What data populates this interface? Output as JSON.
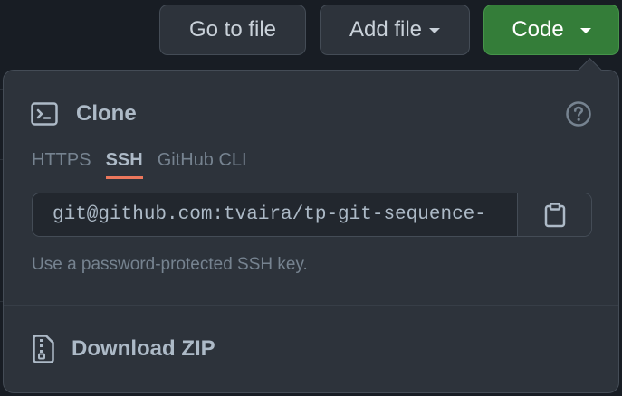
{
  "toolbar": {
    "go_to_file": "Go to file",
    "add_file": "Add file",
    "code": "Code"
  },
  "clone": {
    "title": "Clone",
    "tabs": [
      {
        "label": "HTTPS",
        "active": false
      },
      {
        "label": "SSH",
        "active": true
      },
      {
        "label": "GitHub CLI",
        "active": false
      }
    ],
    "url_value": "git@github.com:tvaira/tp-git-sequence-",
    "hint": "Use a password-protected SSH key."
  },
  "download": {
    "label": "Download ZIP"
  },
  "colors": {
    "code_button": "#347d39",
    "active_tab_underline": "#ec775c",
    "panel_bg": "#2d333b"
  },
  "icons": {
    "terminal": "terminal-icon",
    "help": "question-icon",
    "copy": "clipboard-icon",
    "zip": "file-zip-icon"
  }
}
